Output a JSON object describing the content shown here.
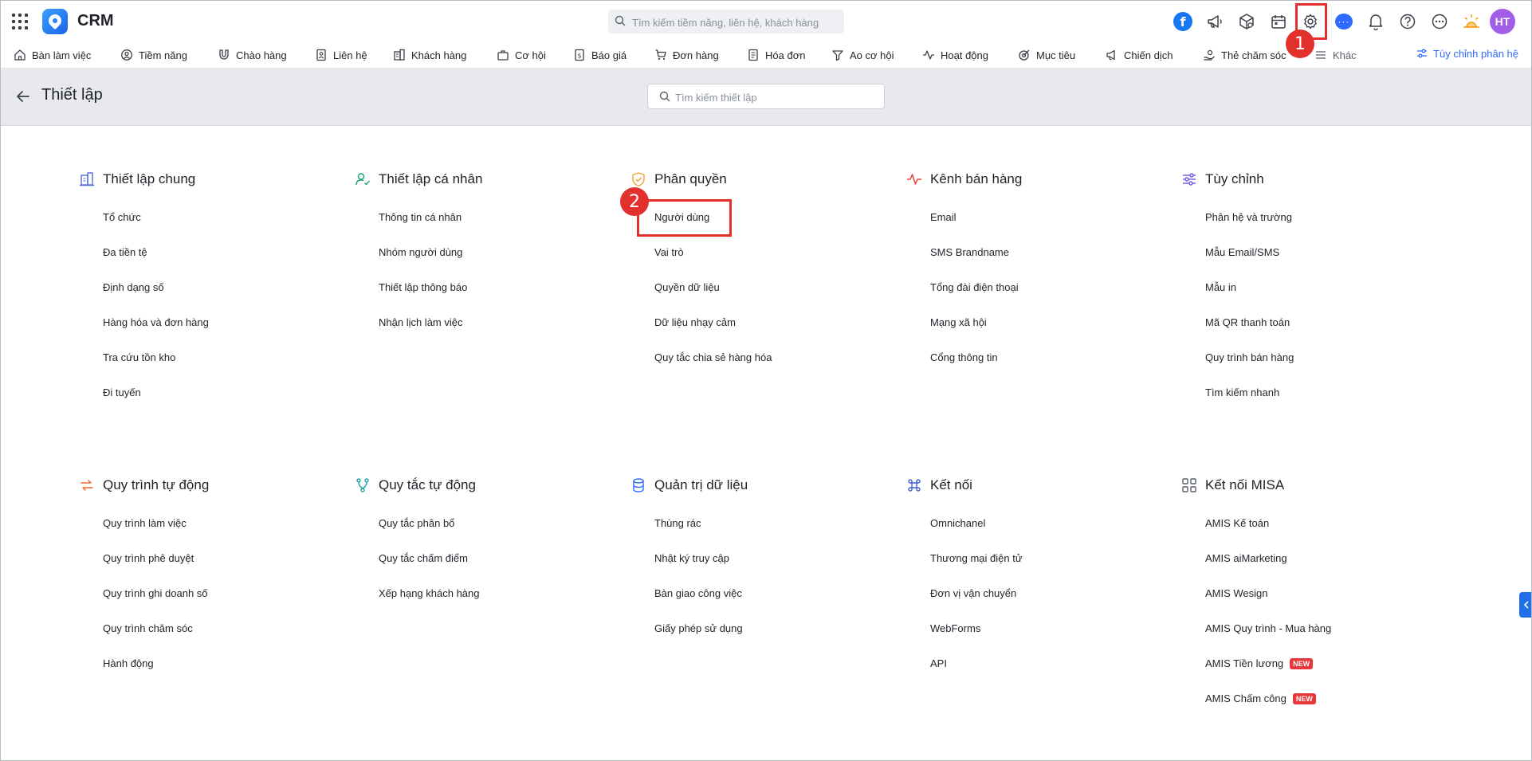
{
  "app": {
    "title": "CRM"
  },
  "topbar": {
    "search_placeholder": "Tìm kiếm tiềm năng, liên hệ, khách hàng",
    "avatar_initials": "HT",
    "fb_letter": "f"
  },
  "menu": {
    "items": [
      {
        "label": "Bàn làm việc"
      },
      {
        "label": "Tiềm năng"
      },
      {
        "label": "Chào hàng"
      },
      {
        "label": "Liên hệ"
      },
      {
        "label": "Khách hàng"
      },
      {
        "label": "Cơ hội"
      },
      {
        "label": "Báo giá"
      },
      {
        "label": "Đơn hàng"
      },
      {
        "label": "Hóa đơn"
      },
      {
        "label": "Ao cơ hội"
      },
      {
        "label": "Hoạt động"
      },
      {
        "label": "Mục tiêu"
      },
      {
        "label": "Chiến dịch"
      },
      {
        "label": "Thẻ chăm sóc"
      }
    ],
    "more_label": "Khác",
    "customize_label": "Tùy chỉnh phân hệ"
  },
  "header": {
    "title": "Thiết lập",
    "search_placeholder": "Tìm kiếm thiết lập"
  },
  "annotations": {
    "step1": "1",
    "step2": "2"
  },
  "new_tag": "NEW",
  "sections": [
    {
      "title": "Thiết lập chung",
      "icon": "building-icon",
      "items": [
        "Tổ chức",
        "Đa tiền tệ",
        "Định dạng số",
        "Hàng hóa và đơn hàng",
        "Tra cứu tồn kho",
        "Đi tuyến"
      ]
    },
    {
      "title": "Thiết lập cá nhân",
      "icon": "user-check-icon",
      "items": [
        "Thông tin cá nhân",
        "Nhóm người dùng",
        "Thiết lập thông báo",
        "Nhận lịch làm việc"
      ]
    },
    {
      "title": "Phân quyền",
      "icon": "shield-icon",
      "items": [
        "Người dùng",
        "Vai trò",
        "Quyền dữ liệu",
        "Dữ liệu nhạy cảm",
        "Quy tắc chia sẻ hàng hóa"
      ]
    },
    {
      "title": "Kênh bán hàng",
      "icon": "pulse-icon",
      "items": [
        "Email",
        "SMS Brandname",
        "Tổng đài điện thoại",
        "Mạng xã hội",
        "Cổng thông tin"
      ]
    },
    {
      "title": "Tùy chỉnh",
      "icon": "sliders-icon",
      "items": [
        "Phân hệ và trường",
        "Mẫu Email/SMS",
        "Mẫu in",
        "Mã QR thanh toán",
        "Quy trình bán hàng",
        "Tìm kiếm nhanh"
      ]
    },
    {
      "title": "Quy trình tự động",
      "icon": "cycle-icon",
      "items": [
        "Quy trình làm việc",
        "Quy trình phê duyệt",
        "Quy trình ghi doanh số",
        "Quy trình chăm sóc",
        "Hành động"
      ]
    },
    {
      "title": "Quy tắc tự động",
      "icon": "branch-icon",
      "items": [
        "Quy tắc phân bổ",
        "Quy tắc chấm điểm",
        "Xếp hạng khách hàng"
      ]
    },
    {
      "title": "Quản trị dữ liệu",
      "icon": "database-icon",
      "items": [
        "Thùng rác",
        "Nhật ký truy cập",
        "Bàn giao công việc",
        "Giấy phép sử dụng"
      ]
    },
    {
      "title": "Kết nối",
      "icon": "command-icon",
      "items": [
        "Omnichanel",
        "Thương mại điện tử",
        "Đơn vị vận chuyển",
        "WebForms",
        "API"
      ]
    },
    {
      "title": "Kết nối MISA",
      "icon": "grid-icon",
      "items": [
        "AMIS Kế toán",
        "AMIS aiMarketing",
        "AMIS Wesign",
        "AMIS Quy trình - Mua hàng",
        "AMIS Tiền lương",
        "AMIS Chấm công"
      ]
    }
  ]
}
